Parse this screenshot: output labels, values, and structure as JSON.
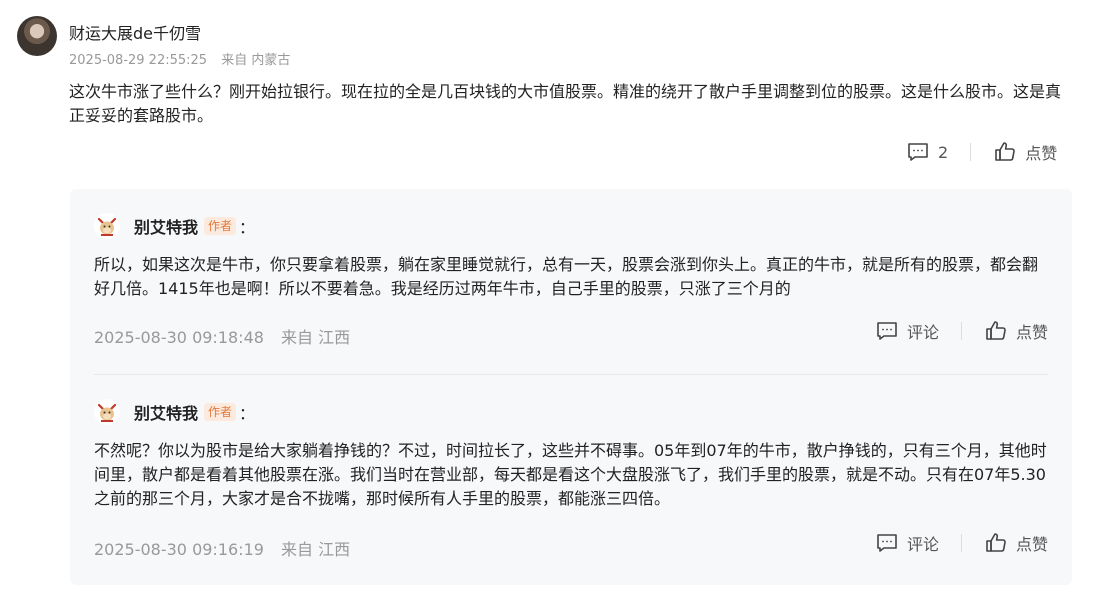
{
  "post": {
    "author": "财运大展de千仞雪",
    "timestamp": "2025-08-29 22:55:25",
    "location": "来自 内蒙古",
    "text": "这次牛市涨了些什么？刚开始拉银行。现在拉的全是几百块钱的大市值股票。精准的绕开了散户手里调整到位的股票。这是什么股市。这是真正妥妥的套路股市。",
    "comment_count": "2",
    "like_label": "点赞"
  },
  "replies": [
    {
      "name": "别艾特我",
      "badge": "作者",
      "colon": "：",
      "text": "所以，如果这次是牛市，你只要拿着股票，躺在家里睡觉就行，总有一天，股票会涨到你头上。真正的牛市，就是所有的股票，都会翻好几倍。1415年也是啊！所以不要着急。我是经历过两年牛市，自己手里的股票，只涨了三个月的",
      "timestamp": "2025-08-30 09:18:48",
      "location": "来自 江西",
      "comment_label": "评论",
      "like_label": "点赞"
    },
    {
      "name": "别艾特我",
      "badge": "作者",
      "colon": "：",
      "text": "不然呢？你以为股市是给大家躺着挣钱的？不过，时间拉长了，这些并不碍事。05年到07年的牛市，散户挣钱的，只有三个月，其他时间里，散户都是看着其他股票在涨。我们当时在营业部，每天都是看这个大盘股涨飞了，我们手里的股票，就是不动。只有在07年5.30之前的那三个月，大家才是合不拢嘴，那时候所有人手里的股票，都能涨三四倍。",
      "timestamp": "2025-08-30 09:16:19",
      "location": "来自 江西",
      "comment_label": "评论",
      "like_label": "点赞"
    }
  ]
}
